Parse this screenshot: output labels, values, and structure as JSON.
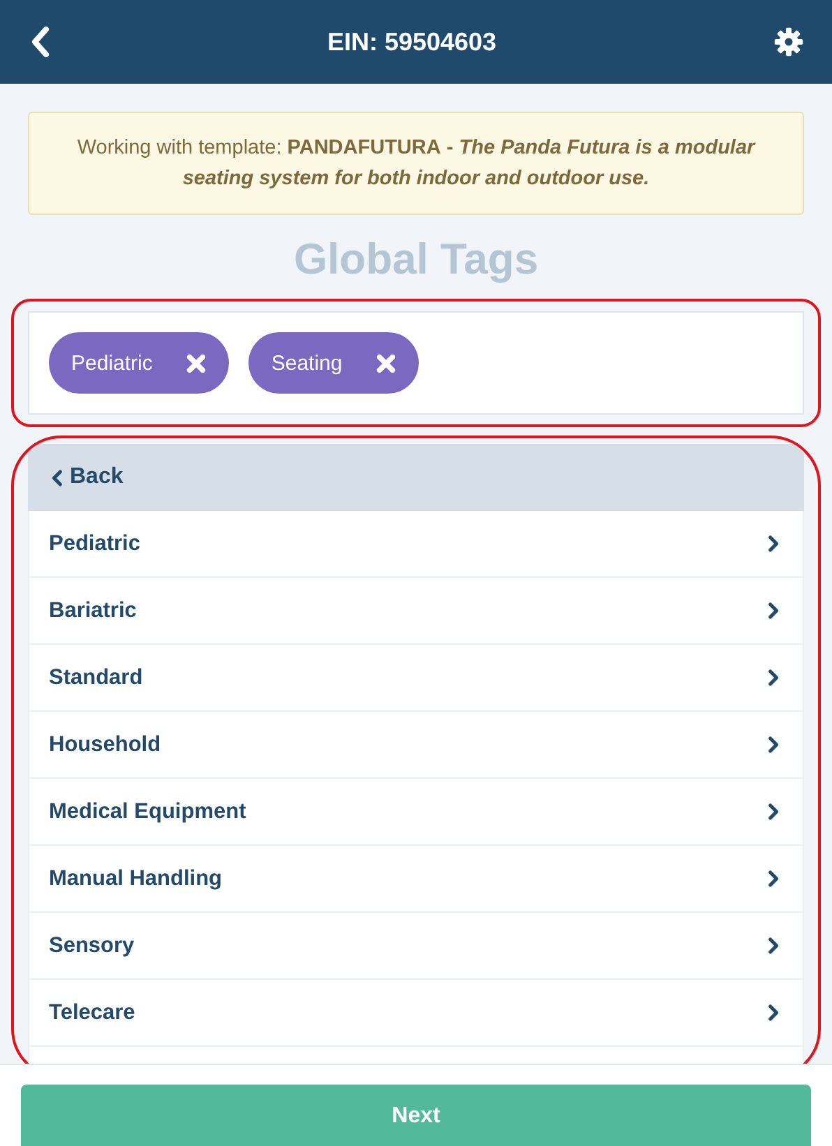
{
  "header": {
    "title": "EIN: 59504603"
  },
  "alert": {
    "prefix": "Working with template:",
    "template_code": "PANDAFUTURA",
    "separator": "-",
    "description": "The Panda Futura is a modular seating system for both indoor and outdoor use."
  },
  "section_title": "Global Tags",
  "tags": [
    {
      "label": "Pediatric"
    },
    {
      "label": "Seating"
    }
  ],
  "menu": {
    "back_label": "Back",
    "items": [
      {
        "label": "Pediatric"
      },
      {
        "label": "Bariatric"
      },
      {
        "label": "Standard"
      },
      {
        "label": "Household"
      },
      {
        "label": "Medical Equipment"
      },
      {
        "label": "Manual Handling"
      },
      {
        "label": "Sensory"
      },
      {
        "label": "Telecare"
      }
    ]
  },
  "footer": {
    "button": "Next"
  }
}
